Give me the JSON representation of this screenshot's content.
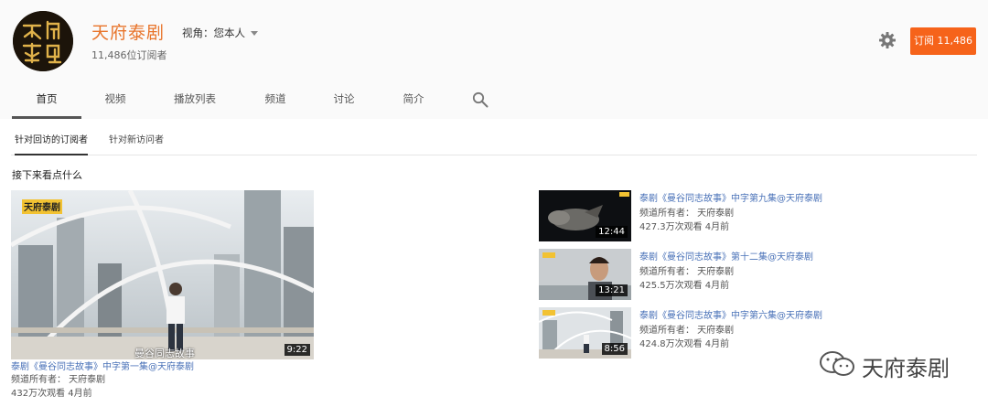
{
  "channel": {
    "name": "天府泰剧",
    "subscribers": "11,486位订阅者",
    "view_as": "视角：您本人",
    "subscribe_label": "订阅 11,486",
    "avatar_icon": "channel-logo-icon"
  },
  "colors": {
    "accent": "#e8742a",
    "subscribe_bg": "#f6631a",
    "link": "#4a72b8",
    "header_bg": "#fafafa"
  },
  "tabs": [
    {
      "label": "首页",
      "active": true
    },
    {
      "label": "视频"
    },
    {
      "label": "播放列表"
    },
    {
      "label": "频道"
    },
    {
      "label": "讨论"
    },
    {
      "label": "简介"
    }
  ],
  "subtabs": [
    {
      "label": "针对回访的订阅者",
      "active": true
    },
    {
      "label": "针对新访问者"
    }
  ],
  "section_title": "接下来看点什么",
  "featured": {
    "title": "泰剧《曼谷同志故事》中字第一集@天府泰剧",
    "owner": "频道所有者： 天府泰剧",
    "stats": "432万次观看 4月前",
    "duration": "9:22",
    "caption": "曼谷同志故事"
  },
  "videos": [
    {
      "title": "泰剧《曼谷同志故事》中字第九集@天府泰剧",
      "owner": "频道所有者： 天府泰剧",
      "stats": "427.3万次观看 4月前",
      "duration": "12:44"
    },
    {
      "title": "泰剧《曼谷同志故事》第十二集@天府泰剧",
      "owner": "频道所有者： 天府泰剧",
      "stats": "425.5万次观看 4月前",
      "duration": "13:21"
    },
    {
      "title": "泰剧《曼谷同志故事》中字第六集@天府泰剧",
      "owner": "频道所有者： 天府泰剧",
      "stats": "424.8万次观看 4月前",
      "duration": "8:56"
    }
  ],
  "watermark": "天府泰剧"
}
